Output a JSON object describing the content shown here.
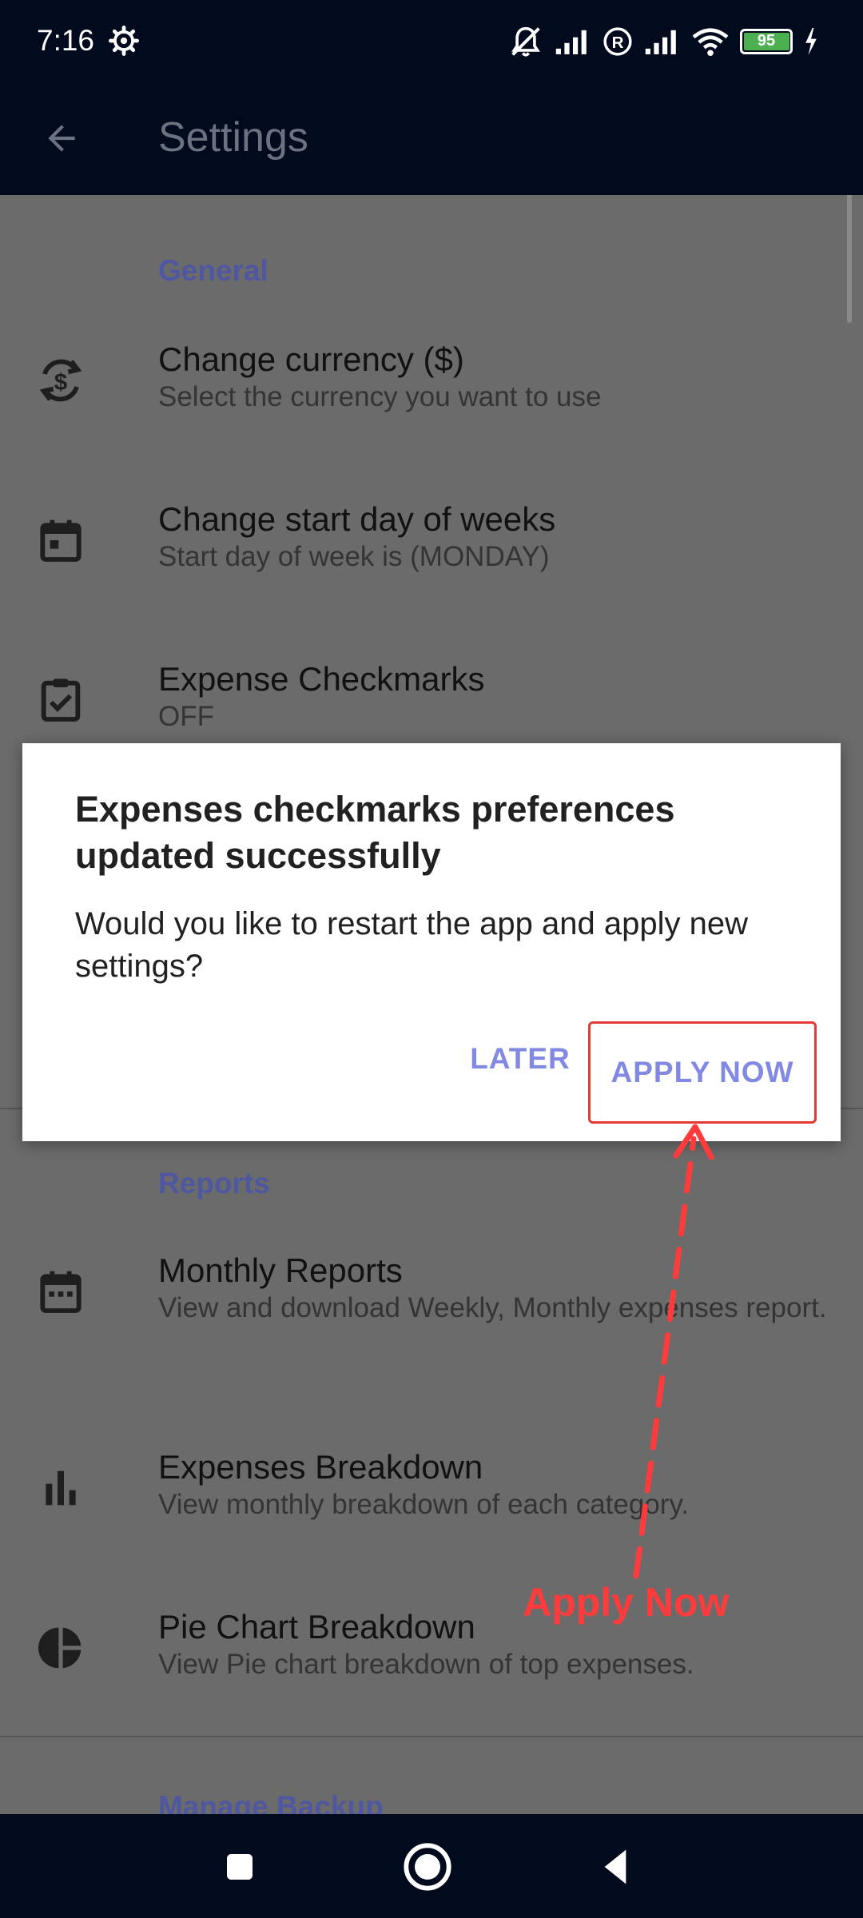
{
  "status_bar": {
    "time": "7:16",
    "battery_level": "95",
    "icons": [
      "gear-icon",
      "mute-icon",
      "signal-icon",
      "roaming-icon",
      "signal-icon",
      "wifi-icon",
      "battery-icon",
      "charging-icon"
    ]
  },
  "app_bar": {
    "title": "Settings"
  },
  "sections": {
    "general": {
      "header": "General",
      "items": [
        {
          "title": "Change currency ($)",
          "subtitle": "Select the currency you want to use",
          "icon": "currency-exchange-icon"
        },
        {
          "title": "Change start day of weeks",
          "subtitle": "Start day of week is (MONDAY)",
          "icon": "calendar-icon"
        },
        {
          "title": "Expense Checkmarks",
          "subtitle": "OFF",
          "icon": "checklist-icon"
        }
      ]
    },
    "reports": {
      "header": "Reports",
      "items": [
        {
          "title": "Monthly Reports",
          "subtitle": "View and download Weekly, Monthly expenses report.",
          "icon": "calendar-month-icon"
        },
        {
          "title": "Expenses Breakdown",
          "subtitle": "View monthly breakdown of each category.",
          "icon": "bar-chart-icon"
        },
        {
          "title": "Pie Chart Breakdown",
          "subtitle": "View Pie chart breakdown of top expenses.",
          "icon": "pie-chart-icon"
        }
      ]
    },
    "backup": {
      "header": "Manage Backup"
    }
  },
  "dialog": {
    "title": "Expenses checkmarks preferences updated successfully",
    "message": "Would you like to restart the app and apply new settings?",
    "later_label": "LATER",
    "apply_label": "APPLY NOW"
  },
  "annotation": {
    "label": "Apply Now",
    "color": "#ff3b3b"
  },
  "nav_bar": {
    "buttons": [
      "recents-icon",
      "home-icon",
      "back-icon"
    ]
  }
}
